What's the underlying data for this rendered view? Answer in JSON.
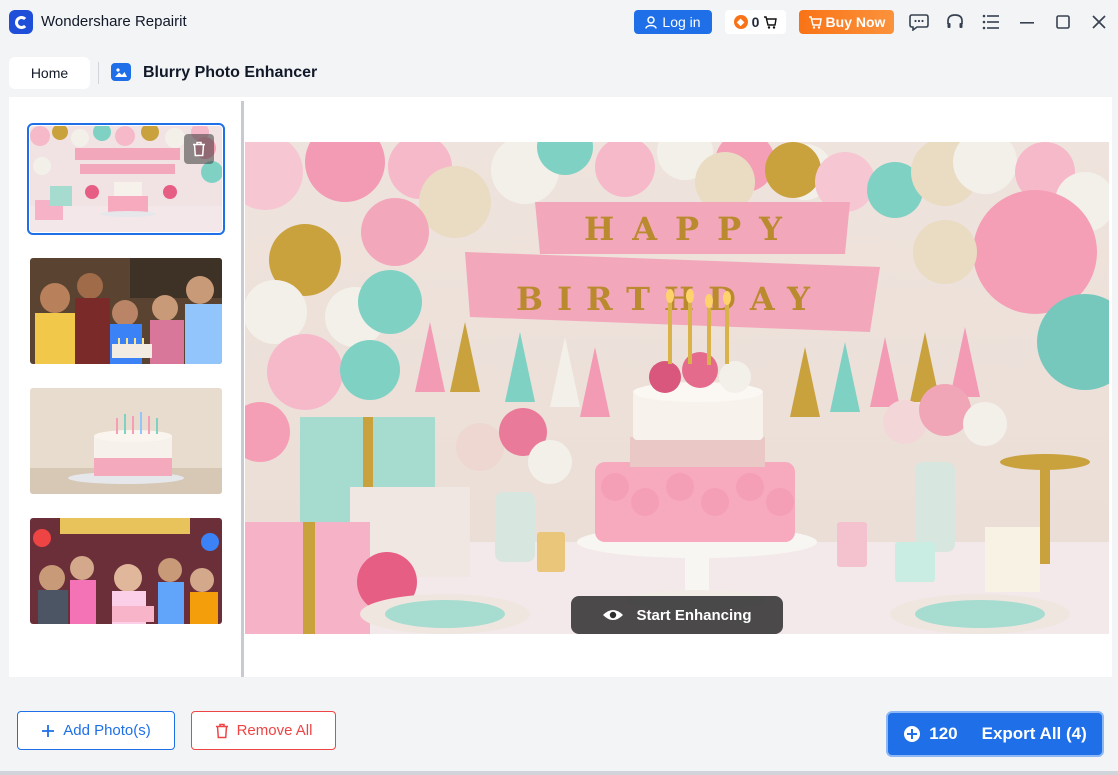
{
  "app": {
    "title": "Wondershare Repairit",
    "login_label": "Log in",
    "credits": "0",
    "buy_label": "Buy Now"
  },
  "nav": {
    "home_tab": "Home",
    "tool_title": "Blurry Photo Enhancer"
  },
  "thumbnails": [
    {
      "theme": "birthday-decor",
      "selected": true
    },
    {
      "theme": "family-cake"
    },
    {
      "theme": "cake-closeup"
    },
    {
      "theme": "kids-party"
    }
  ],
  "preview": {
    "enhance_label": "Start Enhancing"
  },
  "actions": {
    "add_label": "Add Photo(s)",
    "remove_label": "Remove All",
    "export_count": "120",
    "export_label": "Export All (4)"
  },
  "colors": {
    "accent": "#1e6fe8",
    "buy": "#f97316",
    "danger": "#ef4444"
  }
}
